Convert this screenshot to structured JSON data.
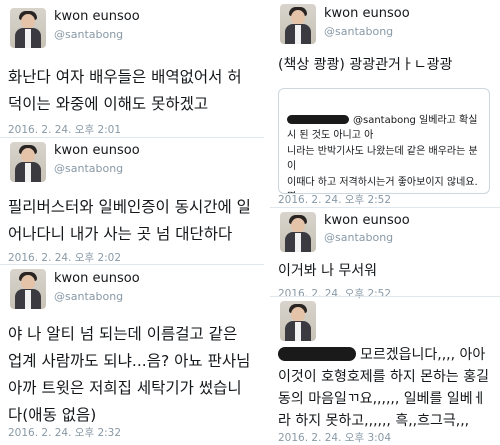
{
  "tweets_left": [
    {
      "name": "kwon eunsoo",
      "handle": "@santabong",
      "text": "화난다 여자 배우들은 배역없어서 허\n덕이는 와중에 이해도 못하겠고",
      "time": "2016. 2. 24. 오후 2:01"
    },
    {
      "name": "kwon eunsoo",
      "handle": "@santabong",
      "text": "필리버스터와 일베인증이 동시간에 일\n어나다니 내가 사는 곳 넘 대단하다",
      "time": "2016. 2. 24. 오후 2:02"
    },
    {
      "name": "kwon eunsoo",
      "handle": "@santabong",
      "text": "야 나 알티 넘 되는데 이름걸고 같은\n업계 사람까도 되냐...음? 아뇨 판사님\n아까 트윗은 저희집 세탁기가 썼습니\n다(애동 없음)",
      "time": "2016. 2. 24. 오후 2:32"
    }
  ],
  "tweets_right": [
    {
      "name": "kwon eunsoo",
      "handle": "@santabong",
      "text": "(책상 쾅쾅) 광광관거ㅏㄴ광광",
      "quote": "@santabong 일베라고 확실시 된 것도 아니고 아\n니라는 반박기사도 나왔는데 같은 배우라는 분이\n이때다 하고 저격하시는거 좋아보이지 않네요.몇\n몇 단어에 끼워맞춰 오해받고 욕먹을 거라는 생각\n은 아예 안하시는 군요.나중에라도 님이 한 발언...",
      "time": "2016. 2. 24. 오후 2:52"
    },
    {
      "name": "kwon eunsoo",
      "handle": "@santabong",
      "text": "이거봐 나 무서워",
      "time": "2016. 2. 24. 오후 2:52"
    },
    {
      "text": "모르겠읍니다,,,, 아아\n이것이 호형호제를 하지 몬하는 홍길\n동의 마음일ㄲ요,,,,,, 일베를 일베ㅔ\n라 하지 못하고,,,,,, 흑,,흐그극,,,",
      "time": "2016. 2. 24. 오후 3:04"
    }
  ]
}
